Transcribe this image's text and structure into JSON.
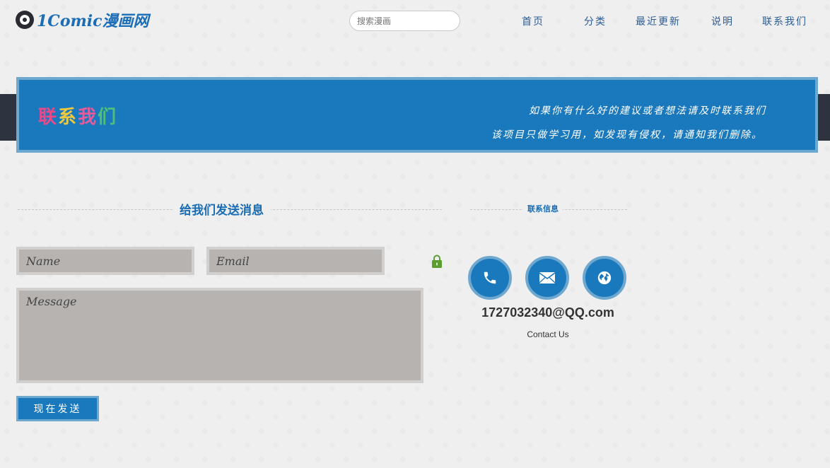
{
  "header": {
    "logo_text": "1Comic漫画网",
    "search_placeholder": "搜索漫画",
    "nav": [
      {
        "label": "首页"
      },
      {
        "label": "分类"
      },
      {
        "label": "最近更新"
      },
      {
        "label": "说明"
      },
      {
        "label": "联系我们"
      }
    ]
  },
  "banner": {
    "title_chars": [
      "联",
      "系",
      "我",
      "们"
    ],
    "line1": "如果你有什么好的建议或者想法请及时联系我们",
    "line2": "该项目只做学习用，如发现有侵权，请通知我们删除。"
  },
  "form": {
    "heading": "给我们发送消息",
    "name_placeholder": "Name",
    "email_placeholder": "Email",
    "message_placeholder": "Message",
    "submit_label": "现在发送"
  },
  "contact": {
    "heading": "联系信息",
    "email": "1727032340@QQ.com",
    "label": "Contact Us"
  },
  "colors": {
    "accent": "#1a78bd",
    "accent_border": "#6fa8cf",
    "heading": "#1a6cb4"
  }
}
